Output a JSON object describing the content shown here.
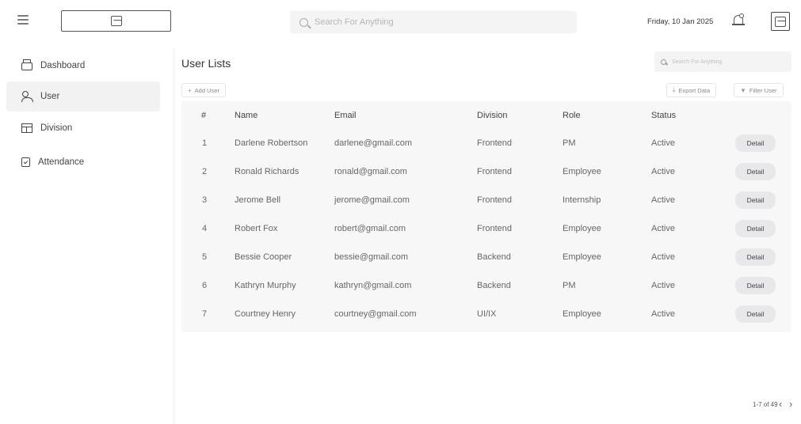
{
  "search": {
    "placeholder": "Search For Anything"
  },
  "header": {
    "date": "Friday, 10 Jan 2025"
  },
  "sidebar": {
    "items": [
      {
        "label": "Dashboard",
        "icon": "print-icon",
        "active": false
      },
      {
        "label": "User",
        "icon": "users-icon",
        "active": true
      },
      {
        "label": "Division",
        "icon": "division-icon",
        "active": false
      },
      {
        "label": "Attendance",
        "icon": "attendance-icon",
        "active": false
      }
    ]
  },
  "main": {
    "title": "User Lists",
    "search_placeholder": "Search For Anything",
    "add_user_label": "Add User",
    "export_label": "Export Data",
    "filter_label": "Filter User"
  },
  "table": {
    "columns": [
      "#",
      "Name",
      "Email",
      "Division",
      "Role",
      "Status"
    ],
    "detail_label": "Detail",
    "rows": [
      {
        "no": "1",
        "name": "Darlene Robertson",
        "email": "darlene@gmail.com",
        "division": "Frontend",
        "role": "PM",
        "status": "Active"
      },
      {
        "no": "2",
        "name": "Ronald Richards",
        "email": "ronald@gmail.com",
        "division": "Frontend",
        "role": "Employee",
        "status": "Active"
      },
      {
        "no": "3",
        "name": "Jerome Bell",
        "email": "jerome@gmail.com",
        "division": "Frontend",
        "role": "Internship",
        "status": "Active"
      },
      {
        "no": "4",
        "name": "Robert Fox",
        "email": "robert@gmail.com",
        "division": "Frontend",
        "role": "Employee",
        "status": "Active"
      },
      {
        "no": "5",
        "name": "Bessie Cooper",
        "email": "bessie@gmail.com",
        "division": "Backend",
        "role": "Employee",
        "status": "Active"
      },
      {
        "no": "6",
        "name": "Kathryn Murphy",
        "email": "kathryn@gmail.com",
        "division": "Backend",
        "role": "PM",
        "status": "Active"
      },
      {
        "no": "7",
        "name": "Courtney Henry",
        "email": "courtney@gmail.com",
        "division": "UI/IX",
        "role": "Employee",
        "status": "Active"
      }
    ]
  },
  "pagination": {
    "label": "1-7 of 49"
  }
}
